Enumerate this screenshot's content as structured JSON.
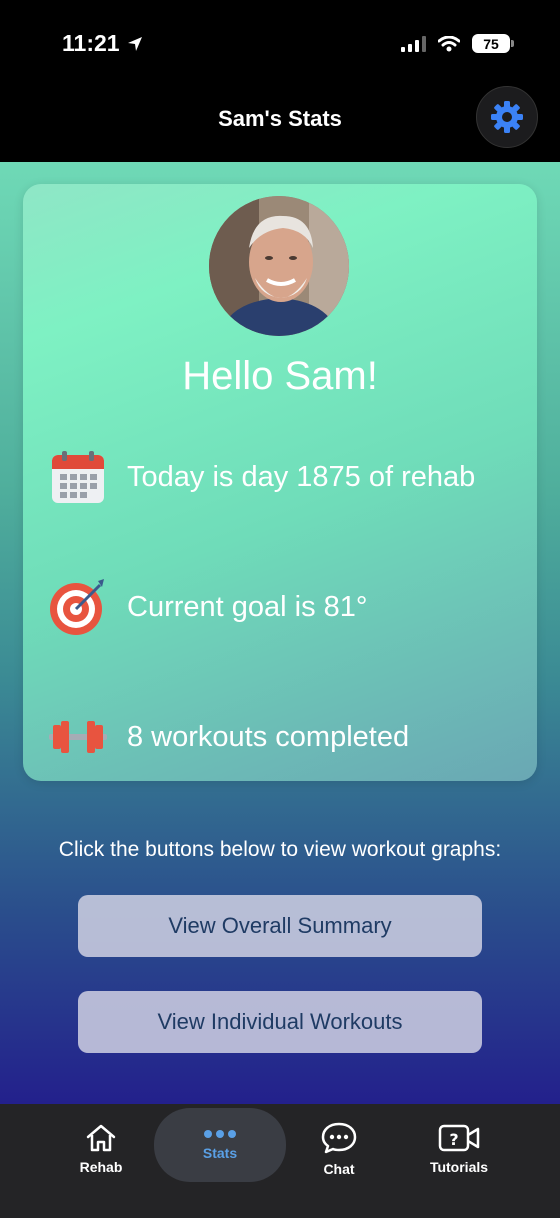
{
  "status_bar": {
    "time": "11:21",
    "battery": "75"
  },
  "header": {
    "title": "Sam's Stats",
    "settings_icon": "gear-icon"
  },
  "card": {
    "greeting": "Hello Sam!",
    "stats": [
      {
        "icon": "calendar-icon",
        "text": "Today is day 1875 of rehab"
      },
      {
        "icon": "target-icon",
        "text": "Current goal is 81°"
      },
      {
        "icon": "dumbbell-icon",
        "text": "8 workouts completed"
      }
    ]
  },
  "instructions": "Click the buttons below to view workout graphs:",
  "buttons": {
    "overall": "View Overall Summary",
    "individual": "View Individual Workouts"
  },
  "nav": {
    "items": [
      {
        "label": "Rehab",
        "icon": "home-icon",
        "active": false
      },
      {
        "label": "Stats",
        "icon": "ellipsis-icon",
        "active": true
      },
      {
        "label": "Chat",
        "icon": "chat-bubble-icon",
        "active": false
      },
      {
        "label": "Tutorials",
        "icon": "video-help-icon",
        "active": false
      }
    ]
  },
  "colors": {
    "accent": "#3b82f6",
    "active_nav": "#5aa0e6",
    "button_text": "#1f3b64"
  }
}
